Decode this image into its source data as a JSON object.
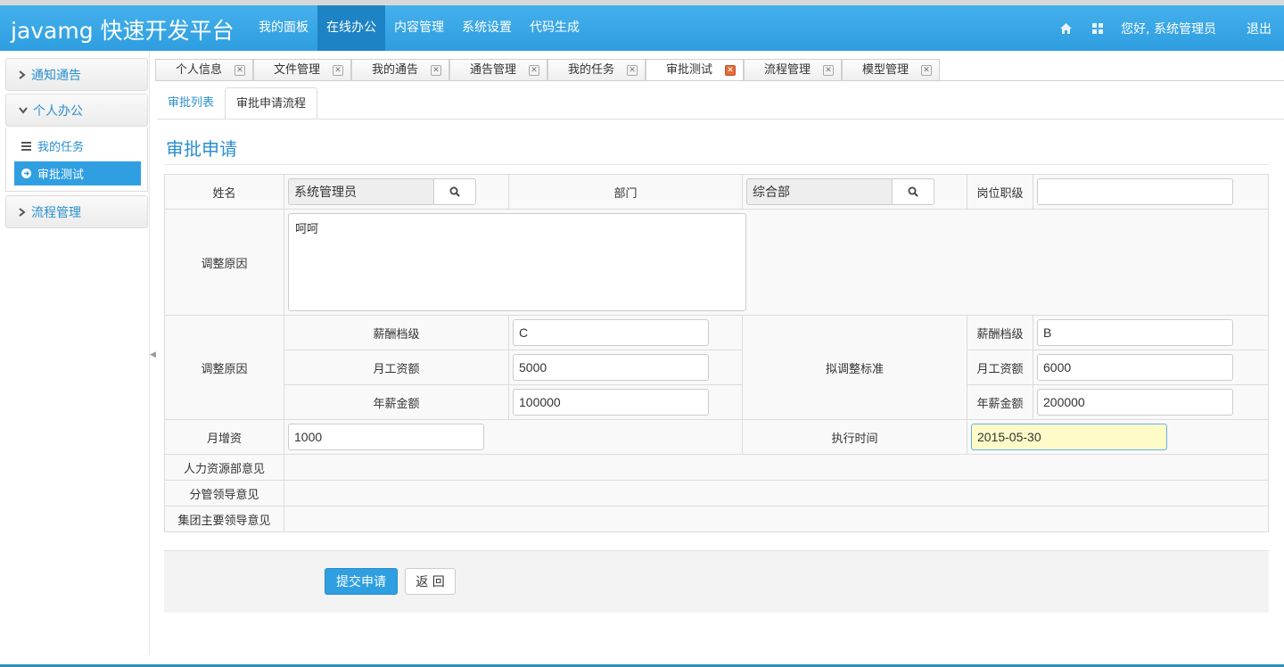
{
  "brand": "javamg 快速开发平台",
  "nav": {
    "items": [
      "我的面板",
      "在线办公",
      "内容管理",
      "系统设置",
      "代码生成"
    ],
    "active": "在线办公",
    "greeting": "您好, 系统管理员",
    "logout": "退出",
    "icons": [
      "home-icon",
      "grid-icon"
    ]
  },
  "sidebar": {
    "sections": [
      {
        "label": "通知通告",
        "icon": "chevron-right-icon"
      },
      {
        "label": "个人办公",
        "icon": "chevron-down-icon",
        "items": [
          {
            "label": "我的任务",
            "icon": "list-icon"
          },
          {
            "label": "审批测试",
            "icon": "circle-arrow-icon",
            "active": true
          }
        ]
      },
      {
        "label": "流程管理",
        "icon": "chevron-right-icon"
      }
    ]
  },
  "tabs": [
    "个人信息",
    "文件管理",
    "我的通告",
    "通告管理",
    "我的任务",
    "审批测试",
    "流程管理",
    "模型管理"
  ],
  "active_tab": "审批测试",
  "subtabs": [
    "审批列表",
    "审批申请流程"
  ],
  "active_subtab": "审批申请流程",
  "form": {
    "title": "审批申请",
    "labels": {
      "name": "姓名",
      "dept": "部门",
      "position": "岗位职级",
      "reason": "调整原因",
      "reason2": "调整原因",
      "salary_level": "薪酬档级",
      "monthly": "月工资额",
      "annual": "年薪金额",
      "proposed": "拟调整标准",
      "raise": "月增资",
      "exec_time": "执行时间",
      "hr_opinion": "人力资源部意见",
      "leader_opinion": "分管领导意见",
      "group_opinion": "集团主要领导意见"
    },
    "values": {
      "name": "系统管理员",
      "dept": "综合部",
      "position": "",
      "reason": "呵呵",
      "cur_level": "C",
      "cur_monthly": "5000",
      "cur_annual": "100000",
      "new_level": "B",
      "new_monthly": "6000",
      "new_annual": "200000",
      "raise": "1000",
      "exec_time": "2015-05-30"
    }
  },
  "buttons": {
    "submit": "提交申请",
    "back": "返 回"
  },
  "colors": {
    "brand_blue": "#2f9fe2",
    "nav_active": "#1d83c4",
    "highlight_input": "#fefbc8"
  }
}
